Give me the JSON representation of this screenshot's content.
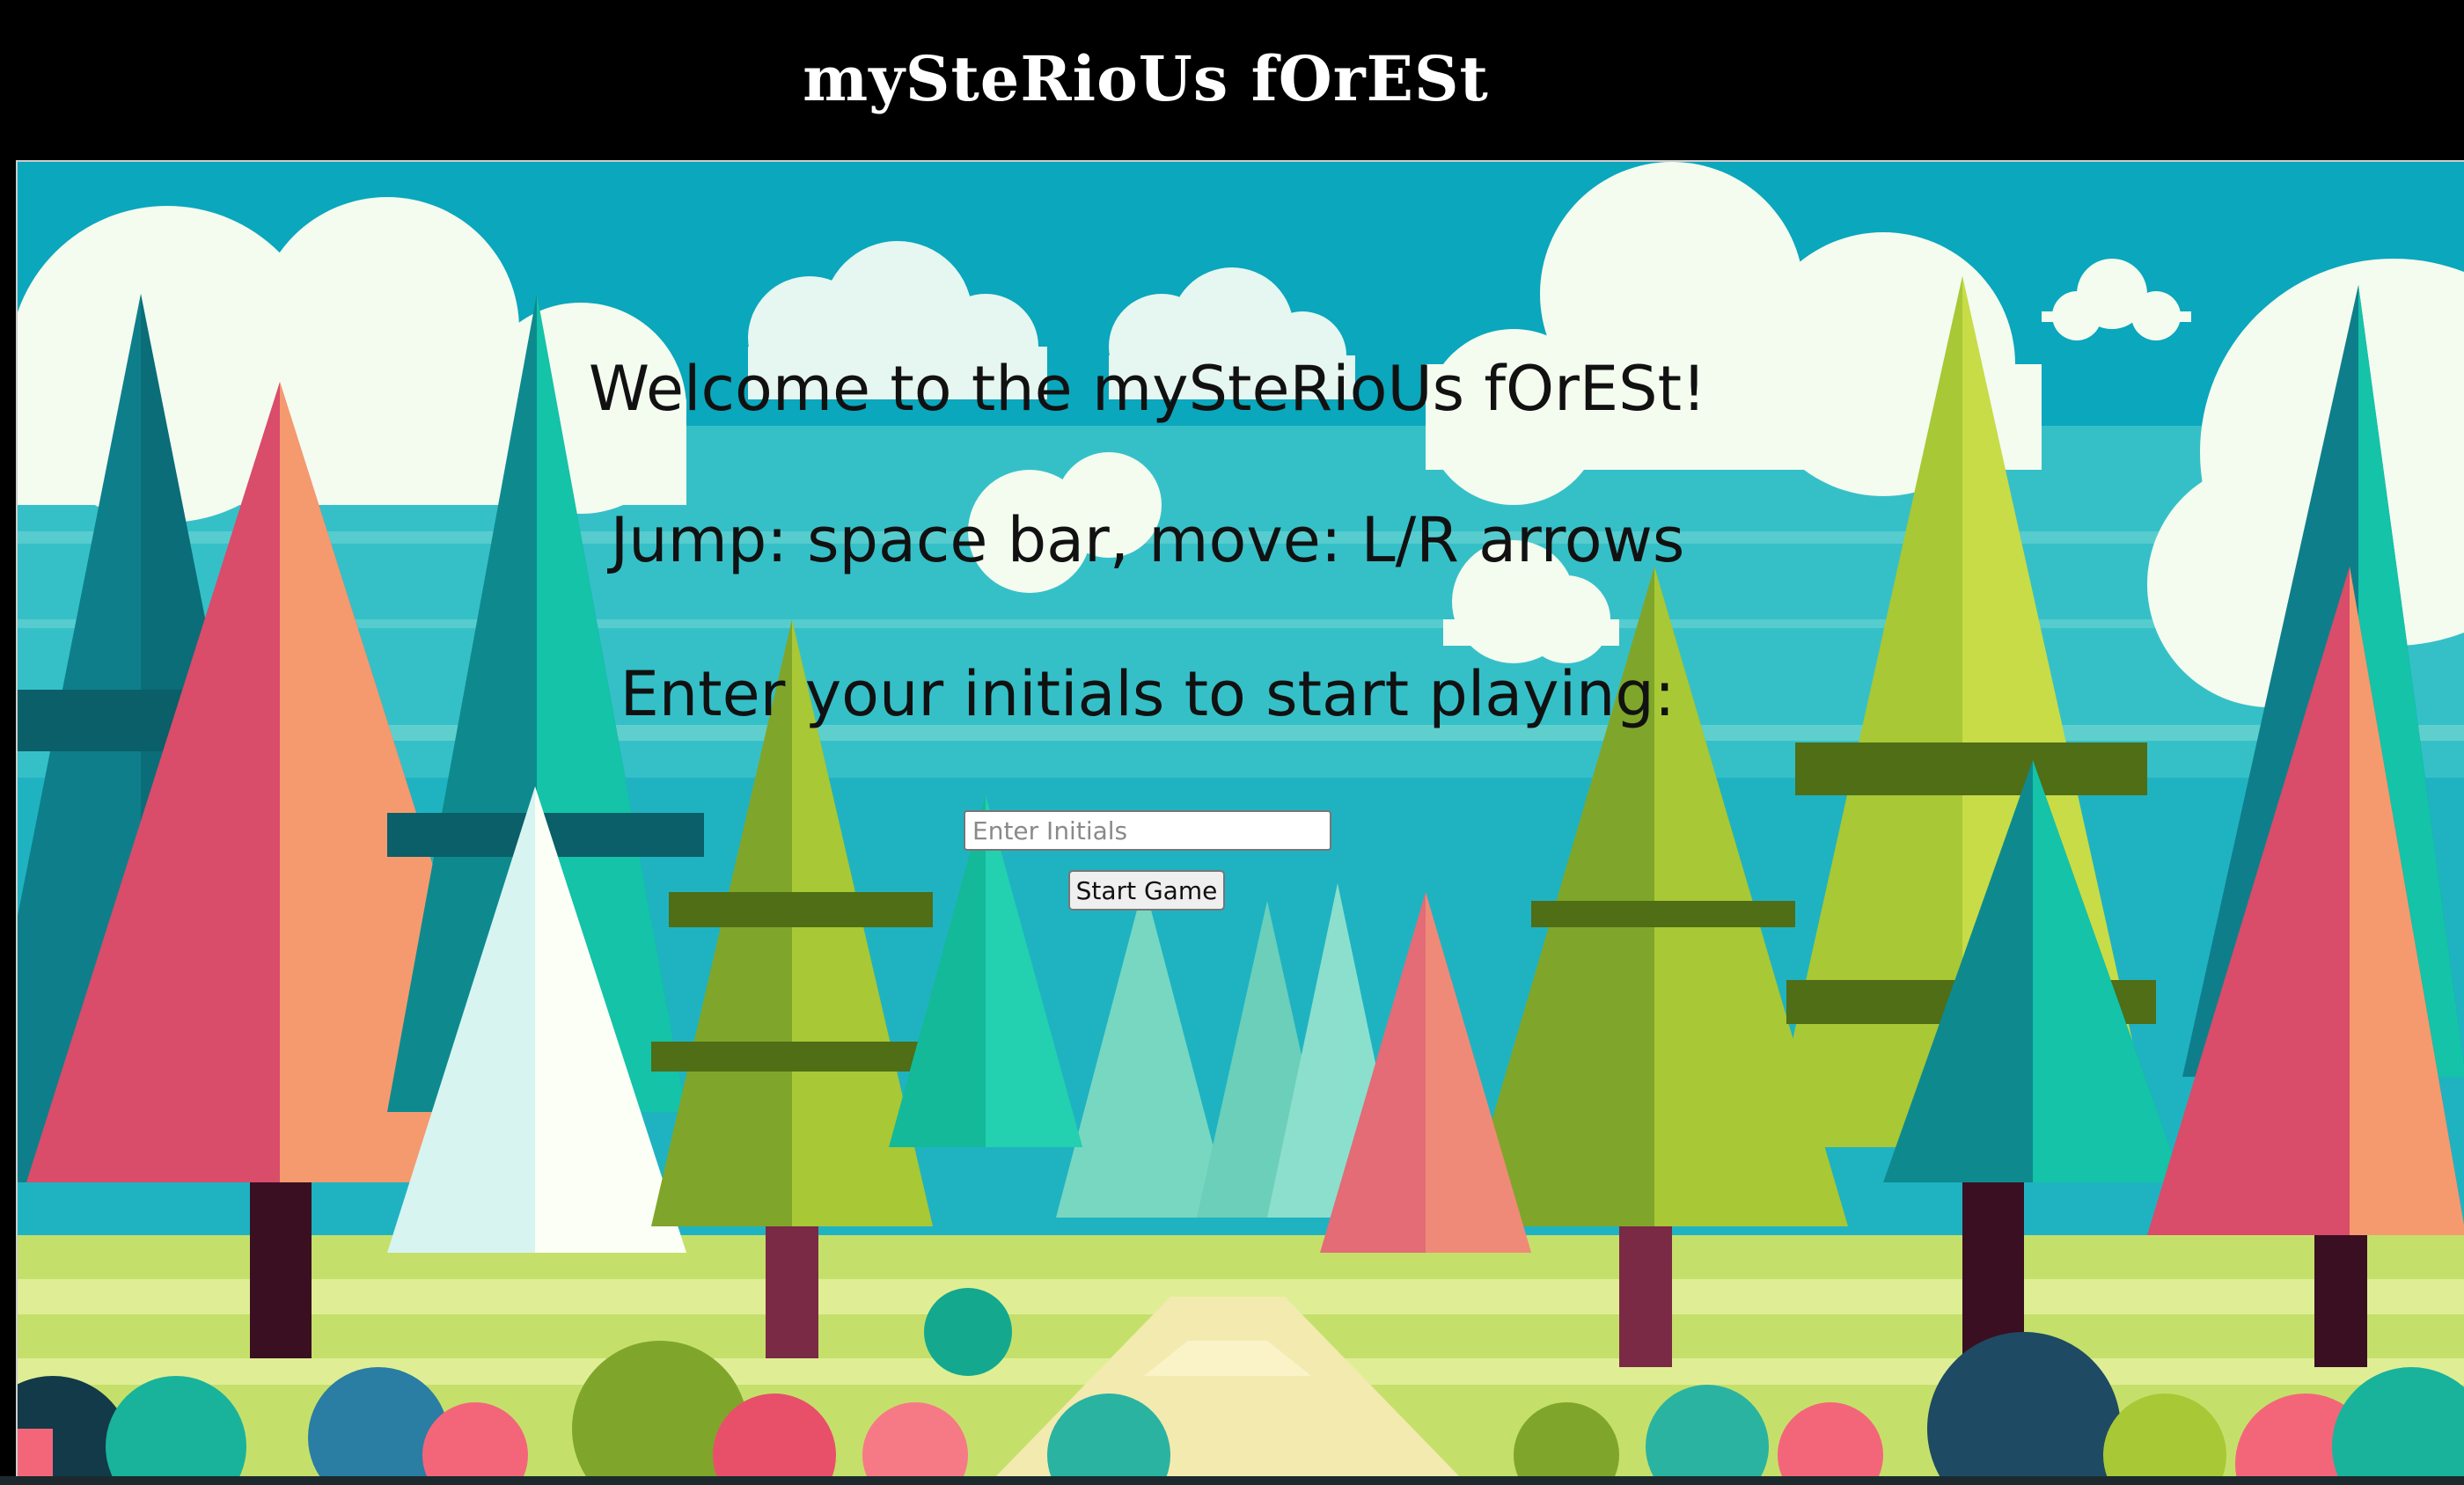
{
  "header": {
    "title": "mySteRioUs fOrESt"
  },
  "welcome": {
    "greeting": "Welcome to the mySteRioUs fOrESt!",
    "controls": "Jump: space bar, move: L/R arrows",
    "prompt": "Enter your initials to start playing:"
  },
  "form": {
    "initials_placeholder": "Enter Initials",
    "initials_value": "",
    "start_label": "Start Game"
  },
  "scene": {
    "sky_color": "#1fb3c2",
    "cloud_color": "#f4fbef",
    "grass_color": "#c5e06a",
    "path_color": "#f3eab0",
    "tree_colors": [
      "#0e7f8a",
      "#14c3a8",
      "#d94c6a",
      "#f59a6e",
      "#a8c835",
      "#7fa62a"
    ],
    "trunk_color": "#7a2a44"
  }
}
